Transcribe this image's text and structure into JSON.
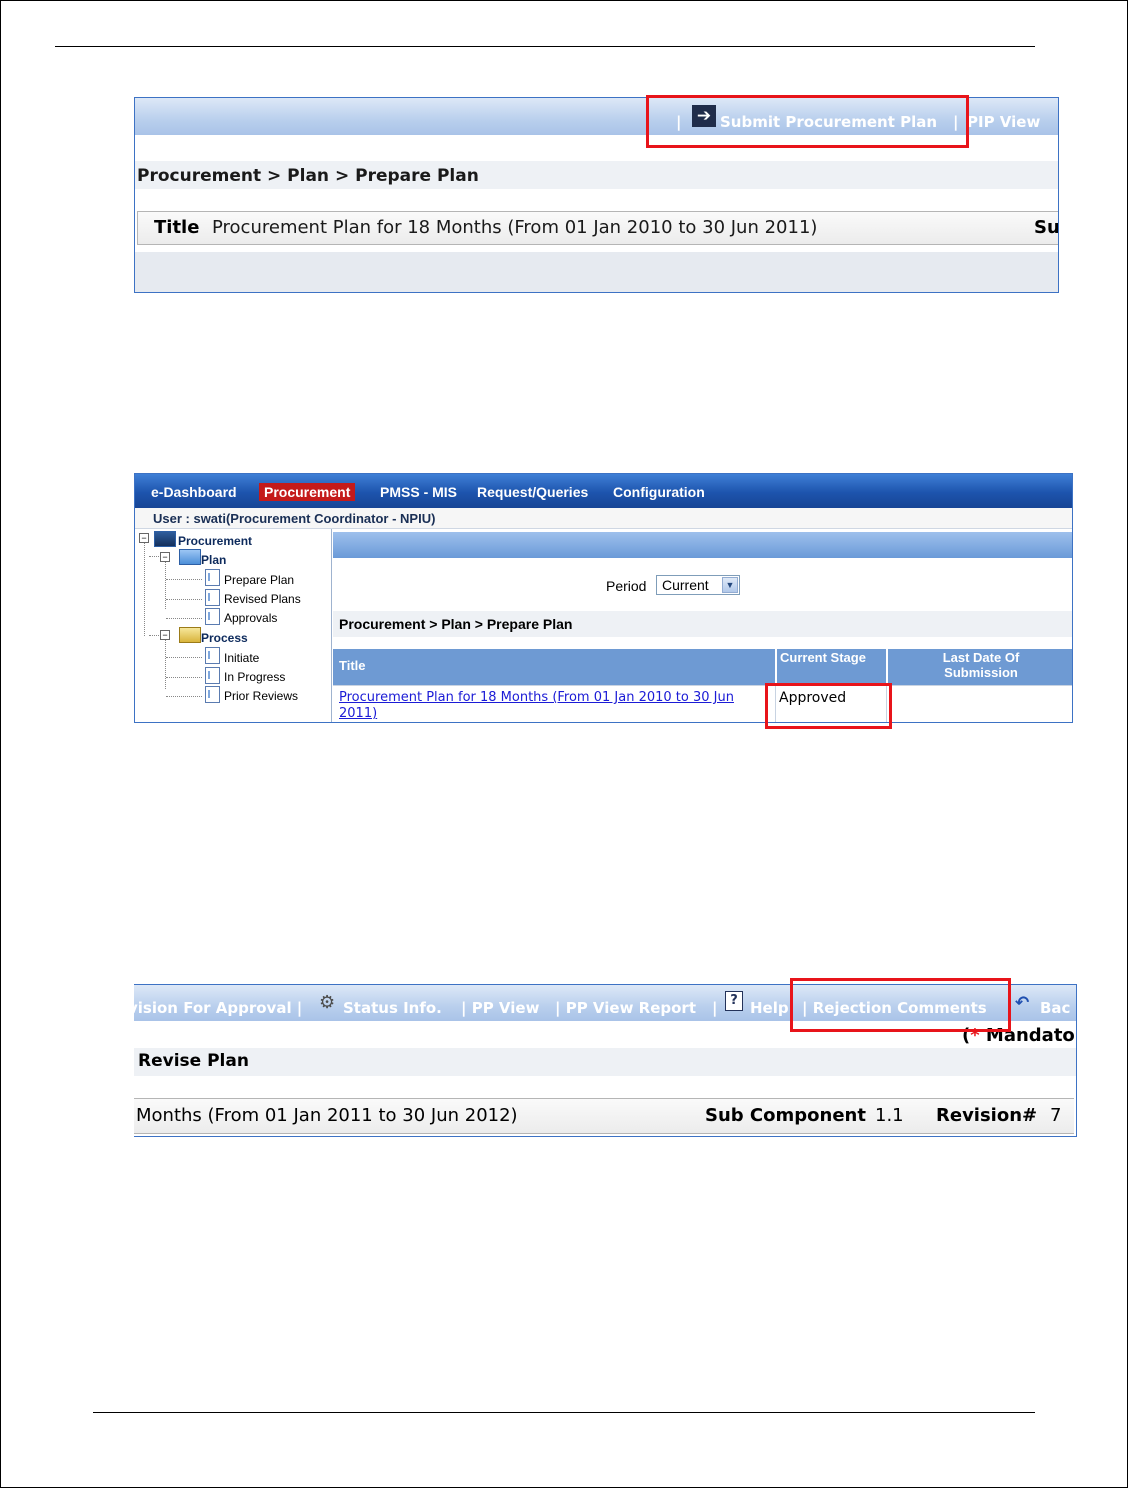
{
  "shot1": {
    "toolbar": {
      "sep1": "|",
      "submit_label": "Submit Procurement Plan",
      "sep2": "|",
      "pip_label": "PIP View"
    },
    "breadcrumb": "Procurement > Plan > Prepare Plan",
    "title_label": "Title",
    "title_value": "Procurement Plan for 18 Months (From 01 Jan 2010 to 30 Jun 2011)",
    "title_sub_partial": "Su"
  },
  "shot2": {
    "nav": [
      "e-Dashboard",
      "Procurement",
      "PMSS - MIS",
      "Request/Queries",
      "Configuration"
    ],
    "user": "User : swati(Procurement Coordinator - NPIU)",
    "tree": {
      "root": "Procurement",
      "plan": "Plan",
      "plan_items": [
        "Prepare Plan",
        "Revised Plans",
        "Approvals"
      ],
      "process": "Process",
      "process_items": [
        "Initiate",
        "In Progress",
        "Prior Reviews"
      ]
    },
    "period_label": "Period",
    "period_value": "Current",
    "breadcrumb": "Procurement > Plan > Prepare Plan",
    "table": {
      "headers": [
        "Title",
        "Current Stage",
        "Last Date Of Submission"
      ],
      "rows": [
        {
          "title": "Procurement Plan for 18 Months (From 01 Jan 2010 to 30 Jun 2011)",
          "stage": "Approved",
          "last_date": ""
        }
      ]
    }
  },
  "shot3": {
    "toolbar": {
      "item1": "vision For Approval |",
      "status": "Status Info.",
      "pp_view": "| PP View",
      "pp_report": "| PP View Report",
      "sep": "|",
      "help": "Help",
      "rejection": "| Rejection Comments",
      "back": "Bac"
    },
    "mandatory_paren": "(",
    "mandatory_star": "*",
    "mandatory_text": " Mandator",
    "breadcrumb": "Revise Plan",
    "row": {
      "months": "Months (From 01 Jan 2011 to 30 Jun 2012)",
      "subcomp_label": "Sub Component",
      "subcomp_value": "1.1",
      "revision_label": "Revision#",
      "revision_value": "7"
    }
  }
}
